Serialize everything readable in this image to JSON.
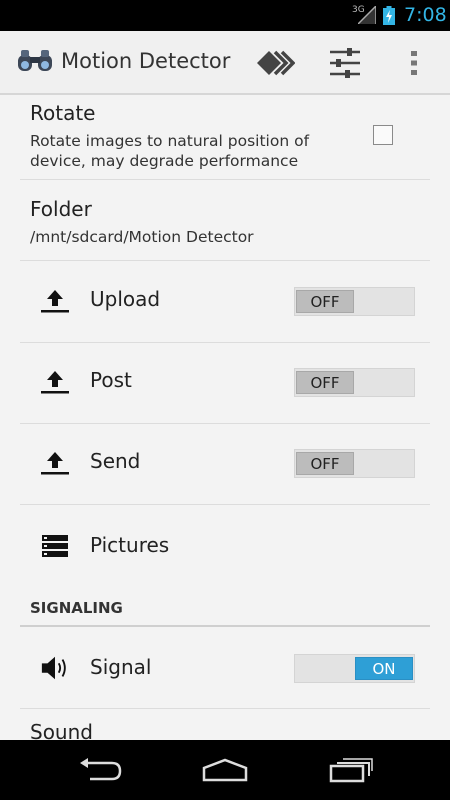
{
  "status_bar": {
    "network": "3G",
    "time": "7:08",
    "accent": "#33b5e5"
  },
  "action_bar": {
    "title": "Motion Detector",
    "icons": [
      "binoculars-icon",
      "forward-chevrons-icon",
      "settings-sliders-icon",
      "overflow-menu-icon"
    ]
  },
  "preferences": {
    "rotate": {
      "title": "Rotate",
      "summary_line1": "Rotate images to natural position of",
      "summary_line2": "device, may degrade performance",
      "checked": false
    },
    "folder": {
      "title": "Folder",
      "summary": "/mnt/sdcard/Motion Detector"
    },
    "upload": {
      "label": "Upload",
      "toggle": "OFF",
      "icon": "upload-icon"
    },
    "post": {
      "label": "Post",
      "toggle": "OFF",
      "icon": "upload-icon"
    },
    "send": {
      "label": "Send",
      "toggle": "OFF",
      "icon": "upload-icon"
    },
    "pictures": {
      "label": "Pictures",
      "icon": "list-icon"
    }
  },
  "signaling": {
    "header": "SIGNALING",
    "signal": {
      "label": "Signal",
      "toggle": "ON",
      "icon": "speaker-icon"
    },
    "sound": {
      "title": "Sound"
    }
  },
  "nav_bar": {
    "icons": [
      "back-icon",
      "home-icon",
      "recent-apps-icon"
    ]
  },
  "colors": {
    "toggle_on": "#2e9fd6",
    "background": "#f3f3f3"
  }
}
